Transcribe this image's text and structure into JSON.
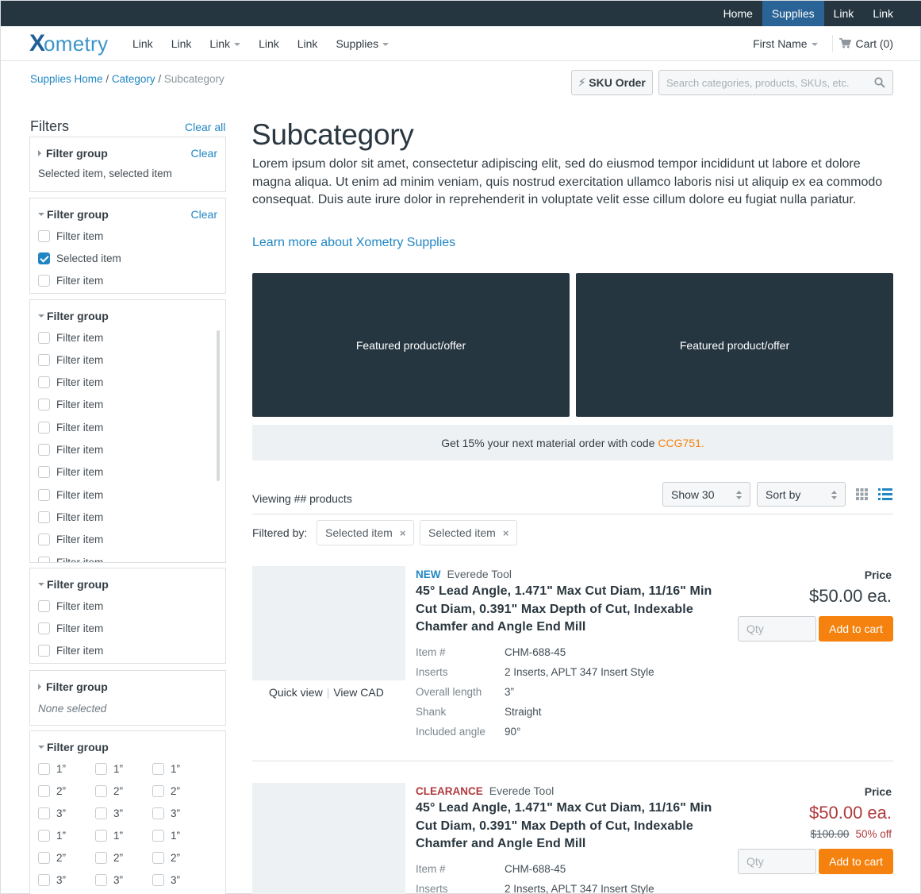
{
  "topbar": {
    "links": [
      {
        "label": "Home",
        "active": false
      },
      {
        "label": "Supplies",
        "active": true
      },
      {
        "label": "Link",
        "active": false
      },
      {
        "label": "Link",
        "active": false
      }
    ]
  },
  "logo": {
    "x": "X",
    "rest": "ometry"
  },
  "mainnav": {
    "links": [
      {
        "label": "Link",
        "dropdown": false
      },
      {
        "label": "Link",
        "dropdown": false
      },
      {
        "label": "Link",
        "dropdown": true
      },
      {
        "label": "Link",
        "dropdown": false
      },
      {
        "label": "Link",
        "dropdown": false
      },
      {
        "label": "Supplies",
        "dropdown": true
      }
    ],
    "user": "First Name",
    "cart": "Cart (0)"
  },
  "breadcrumb": {
    "items": [
      "Supplies Home",
      "Category"
    ],
    "sep": "/",
    "current": "Subcategory"
  },
  "sku_order": {
    "icon": "bolt-icon",
    "label": "SKU Order"
  },
  "search": {
    "placeholder": "Search categories, products, SKUs, etc.",
    "value": "",
    "icon": "search-icon"
  },
  "filters": {
    "title": "Filters",
    "clear_all": "Clear all",
    "groups": [
      {
        "title": "Filter group",
        "expanded": false,
        "clear": "Clear",
        "summary": "Selected item, selected item"
      },
      {
        "title": "Filter group",
        "expanded": true,
        "clear": "Clear",
        "items": [
          {
            "label": "Filter item",
            "checked": false
          },
          {
            "label": "Selected item",
            "checked": true
          },
          {
            "label": "Filter item",
            "checked": false
          }
        ]
      },
      {
        "title": "Filter group",
        "expanded": true,
        "scrollable": true,
        "items": [
          {
            "label": "Filter item",
            "checked": false
          },
          {
            "label": "Filter item",
            "checked": false
          },
          {
            "label": "Filter item",
            "checked": false
          },
          {
            "label": "Filter item",
            "checked": false
          },
          {
            "label": "Filter item",
            "checked": false
          },
          {
            "label": "Filter item",
            "checked": false
          },
          {
            "label": "Filter item",
            "checked": false
          },
          {
            "label": "Filter item",
            "checked": false
          },
          {
            "label": "Filter item",
            "checked": false
          },
          {
            "label": "Filter item",
            "checked": false
          },
          {
            "label": "Filter item",
            "checked": false
          }
        ]
      },
      {
        "title": "Filter group",
        "expanded": true,
        "items": [
          {
            "label": "Filter item",
            "checked": false
          },
          {
            "label": "Filter item",
            "checked": false
          },
          {
            "label": "Filter item",
            "checked": false
          }
        ]
      },
      {
        "title": "Filter group",
        "expanded": false,
        "summary": "None selected"
      },
      {
        "title": "Filter group",
        "expanded": true,
        "grid": [
          "1”",
          "1”",
          "1”",
          "2”",
          "2”",
          "2”",
          "3”",
          "3”",
          "3”",
          "1”",
          "1”",
          "1”",
          "2”",
          "2”",
          "2”",
          "3”",
          "3”",
          "3”"
        ]
      }
    ]
  },
  "page": {
    "title": "Subcategory",
    "lead": "Lorem ipsum dolor sit amet, consectetur adipiscing elit, sed do eiusmod tempor incididunt ut labore et dolore magna aliqua. Ut enim ad minim veniam, quis nostrud exercitation ullamco laboris nisi ut aliquip ex ea commodo consequat. Duis aute irure dolor in reprehenderit in voluptate velit esse cillum dolore eu fugiat nulla pariatur.",
    "learn_more": "Learn more about Xometry Supplies",
    "featured": [
      "Featured product/offer",
      "Featured product/offer"
    ],
    "promo": {
      "text": "Get 15% your next material order with code",
      "code": "CCG751."
    }
  },
  "listing": {
    "viewing": "Viewing ## products",
    "show": "Show 30",
    "sort": "Sort by",
    "view_grid_icon": "grid-view-icon",
    "view_list_icon": "list-view-icon",
    "active_view": "list",
    "filtered_by": "Filtered by:",
    "chips": [
      "Selected item",
      "Selected item"
    ],
    "chip_remove": "×"
  },
  "products": [
    {
      "badge": "NEW",
      "badge_color": "#1f86c3",
      "brand": "Everede Tool",
      "title": "45° Lead Angle, 1.471\" Max Cut Diam, 11/16\" Min Cut Diam, 0.391\" Max Depth of Cut, Indexable Chamfer and Angle End Mill",
      "quick_view": "Quick view",
      "view_cad": "View CAD",
      "specs": [
        {
          "k": "Item #",
          "v": "CHM-688-45"
        },
        {
          "k": "Inserts",
          "v": "2 Inserts, APLT 347 Insert Style"
        },
        {
          "k": "Overall length",
          "v": "3”"
        },
        {
          "k": "Shank",
          "v": "Straight"
        },
        {
          "k": "Included angle",
          "v": "90°"
        }
      ],
      "price_label": "Price",
      "price": "$50.00 ea.",
      "qty_placeholder": "Qty",
      "add_label": "Add to cart"
    },
    {
      "badge": "CLEARANCE",
      "badge_color": "#b0393d",
      "brand": "Everede Tool",
      "title": "45° Lead Angle, 1.471\" Max Cut Diam, 11/16\" Min Cut Diam, 0.391\" Max Depth of Cut, Indexable Chamfer and Angle End Mill",
      "specs": [
        {
          "k": "Item #",
          "v": "CHM-688-45"
        },
        {
          "k": "Inserts",
          "v": "2 Inserts, APLT 347 Insert Style"
        }
      ],
      "price_label": "Price",
      "price": "$50.00 ea.",
      "was_price": "$100.00",
      "discount": "50% off",
      "qty_placeholder": "Qty",
      "add_label": "Add to cart"
    }
  ],
  "colors": {
    "nav_dark": "#263641",
    "accent_blue": "#1f86c3",
    "orange": "#f5820e",
    "clearance_red": "#b0393d"
  }
}
